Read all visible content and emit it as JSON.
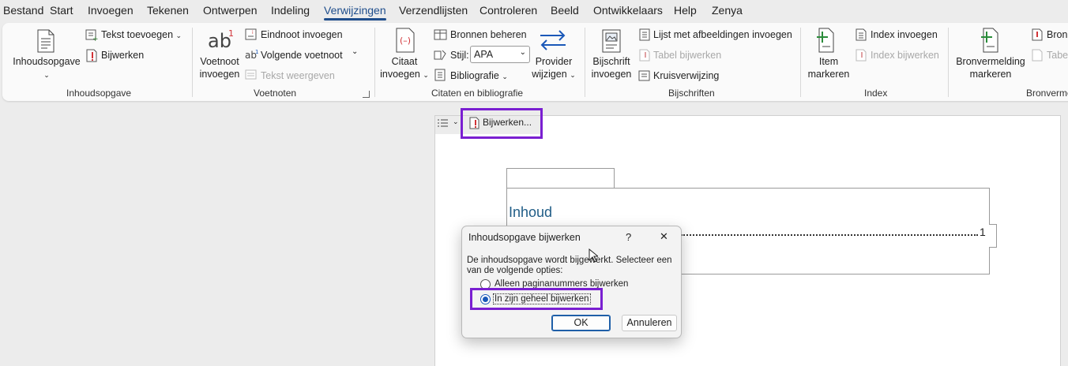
{
  "menu_tabs": [
    "Bestand",
    "Start",
    "Invoegen",
    "Tekenen",
    "Ontwerpen",
    "Indeling",
    "Verwijzingen",
    "Verzendlijsten",
    "Controleren",
    "Beeld",
    "Ontwikkelaars",
    "Help",
    "Zenya"
  ],
  "active_tab": "Verwijzingen",
  "ribbon": {
    "toc": {
      "big_button": "Inhoudsopgave",
      "add_text": "Tekst toevoegen",
      "update": "Bijwerken",
      "group_label": "Inhoudsopgave"
    },
    "footnotes": {
      "footnote_line1": "Voetnoot",
      "footnote_line2": "invoegen",
      "endnote": "Eindnoot invoegen",
      "next_footnote": "Volgende voetnoot",
      "show_notes": "Tekst weergeven",
      "group_label": "Voetnoten"
    },
    "citations": {
      "citation_line1": "Citaat",
      "citation_line2": "invoegen",
      "manage_sources": "Bronnen beheren",
      "style_label": "Stijl:",
      "style_value": "APA",
      "bibliography": "Bibliografie",
      "provider_line1": "Provider",
      "provider_line2": "wijzigen",
      "group_label": "Citaten en bibliografie"
    },
    "captions": {
      "caption_line1": "Bijschrift",
      "caption_line2": "invoegen",
      "insert_figures": "Lijst met afbeeldingen invoegen",
      "update_table": "Tabel bijwerken",
      "cross_ref": "Kruisverwijzing",
      "group_label": "Bijschriften"
    },
    "index": {
      "mark_line1": "Item",
      "mark_line2": "markeren",
      "insert_index": "Index invoegen",
      "update_index": "Index bijwerken",
      "group_label": "Index"
    },
    "authorities": {
      "mark_line1": "Bronvermelding",
      "mark_line2": "markeren",
      "insert_partial": "Bron",
      "update_partial": "Tabel",
      "group_label_partial": "Bronverme"
    }
  },
  "document": {
    "toc_update_button": "Bijwerken...",
    "toc_heading": "Inhoud",
    "toc_page_number": "1"
  },
  "dialog": {
    "title": "Inhoudsopgave bijwerken",
    "help": "?",
    "close": "✕",
    "message_line1": "De inhoudsopgave wordt bijgewerkt. Selecteer een",
    "message_line2": "van de volgende opties:",
    "option1": "Alleen paginanummers bijwerken",
    "option2": "In zijn geheel bijwerken",
    "ok": "OK",
    "cancel": "Annuleren"
  },
  "colors": {
    "accent": "#1f4e8c",
    "highlight": "#7a1fd1",
    "heading": "#1f5c86"
  }
}
